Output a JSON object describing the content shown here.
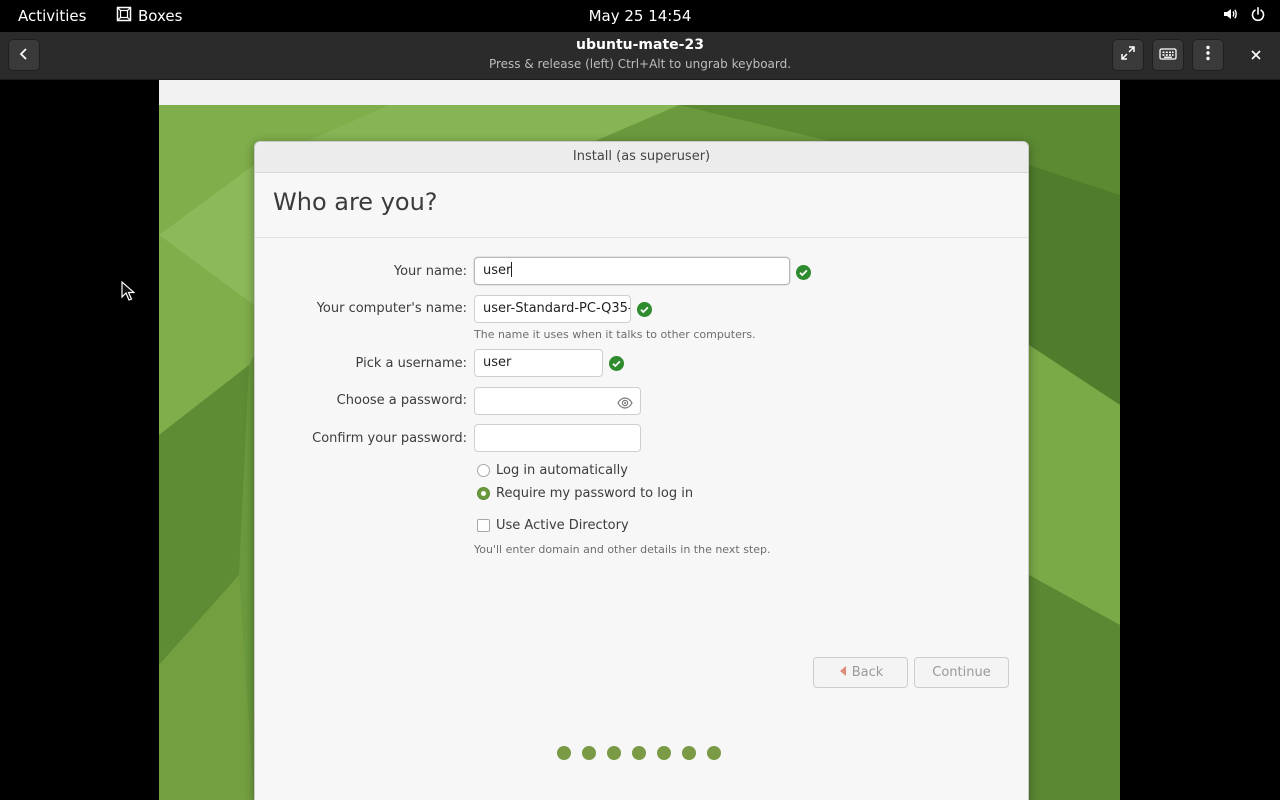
{
  "topbar": {
    "activities": "Activities",
    "app_name": "Boxes",
    "clock": "May 25  14:54"
  },
  "headerbar": {
    "title": "ubuntu-mate-23",
    "subtitle": "Press & release (left) Ctrl+Alt to ungrab keyboard."
  },
  "installer": {
    "window_title": "Install (as superuser)",
    "heading": "Who are you?",
    "your_name_label": "Your name:",
    "your_name_value": "user",
    "computer_name_label": "Your computer's name:",
    "computer_name_value": "user-Standard-PC-Q35-",
    "computer_name_hint": "The name it uses when it talks to other computers.",
    "username_label": "Pick a username:",
    "username_value": "user",
    "password_label": "Choose a password:",
    "confirm_password_label": "Confirm your password:",
    "login_auto_label": "Log in automatically",
    "require_password_label": "Require my password to log in",
    "selected_login_option": "Require my password to log in",
    "active_directory_label": "Use Active Directory",
    "active_directory_checked": false,
    "active_directory_hint": "You'll enter domain and other details in the next step.",
    "back_label": "Back",
    "continue_label": "Continue",
    "progress_steps": 7
  },
  "colors": {
    "accent_green": "#6a9a3d",
    "check_green": "#2e8b2e",
    "progress_dot": "#7a9a45"
  }
}
